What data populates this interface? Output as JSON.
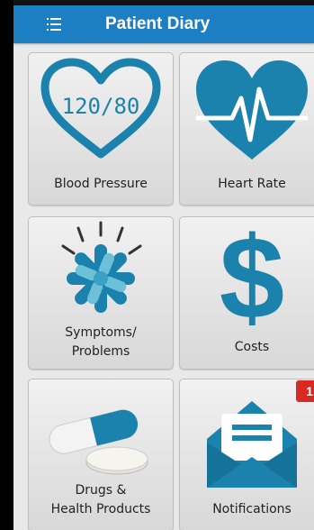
{
  "app": {
    "title": "Patient Diary"
  },
  "tiles": [
    {
      "label": "Blood Pressure",
      "icon_text": "120/80"
    },
    {
      "label": "Heart Rate"
    },
    {
      "label_line1": "Symptoms/",
      "label_line2": "Problems"
    },
    {
      "label": "Costs"
    },
    {
      "label_line1": "Drugs &",
      "label_line2": "Health Products"
    },
    {
      "label": "Notifications",
      "badge": "1"
    }
  ],
  "colors": {
    "appbar": "#1c7fc4",
    "icon": "#1a82ad",
    "badge": "#d62a22"
  }
}
